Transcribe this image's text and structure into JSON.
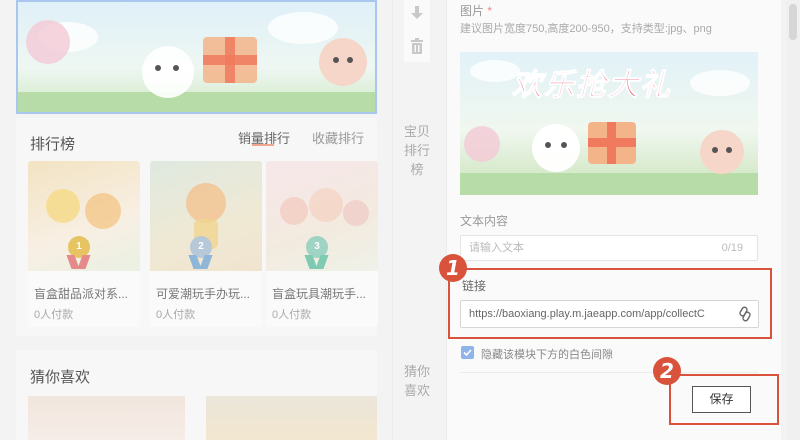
{
  "preview": {
    "ranking": {
      "title": "排行榜",
      "tabs": [
        "销量排行",
        "收藏排行"
      ],
      "active_tab": "销量排行",
      "items": [
        {
          "name": "盲盒甜品派对系...",
          "paid": "0人付款",
          "rank": "1"
        },
        {
          "name": "可爱潮玩手办玩...",
          "paid": "0人付款",
          "rank": "2"
        },
        {
          "name": "盲盒玩具潮玩手...",
          "paid": "0人付款",
          "rank": "3"
        }
      ]
    },
    "guess": {
      "title": "猜你喜欢"
    }
  },
  "side_labels": {
    "ranking": "宝贝排行榜",
    "guess": "猜你喜欢"
  },
  "editor": {
    "image_label": "图片",
    "required_mark": "*",
    "image_hint": "建议图片宽度750,高度200-950，支持类型:jpg、png",
    "banner_text": "欢乐抢大礼",
    "text_label": "文本内容",
    "text_placeholder": "请输入文本",
    "text_counter": "0/19",
    "link_label": "链接",
    "link_value": "https://baoxiang.play.m.jaeapp.com/app/collectC",
    "hide_gap_label": "隐藏该模块下方的白色间隙",
    "hide_gap_checked": true,
    "save_label": "保存"
  },
  "annotations": {
    "badge1": "1",
    "badge2": "2"
  },
  "colors": {
    "highlight": "#d9533c",
    "checkbox": "#8fb4ea",
    "tab_underline": "#f0a78e"
  }
}
